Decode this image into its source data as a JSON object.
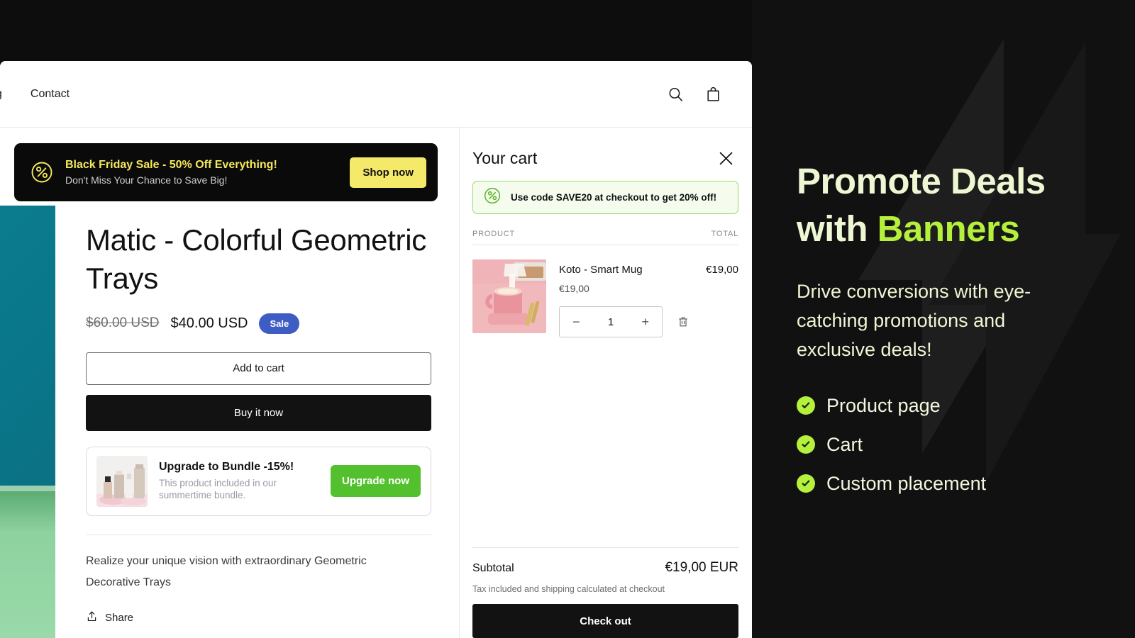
{
  "store": {
    "nav": {
      "truncated_item": "g",
      "links": [
        "Contact"
      ],
      "search_icon": "search-icon",
      "cart_icon": "shopping-bag-icon"
    },
    "black_friday_banner": {
      "icon": "percent-circle-icon",
      "title": "Black Friday Sale - 50% Off Everything!",
      "subtitle": "Don't Miss Your Chance to Save Big!",
      "button": "Shop now",
      "bg": "#0a0a0a",
      "title_color": "#f4e85c",
      "button_bg": "#f5e96a"
    },
    "product": {
      "title": "Matic - Colorful Geometric Trays",
      "price_old": "$60.00 USD",
      "price_new": "$40.00 USD",
      "sale_badge": "Sale",
      "sale_badge_color": "#3d5cc4",
      "add_to_cart": "Add to cart",
      "buy_it_now": "Buy it now",
      "description": "Realize your unique vision with extraordinary Geometric Decorative Trays",
      "share": "Share",
      "share_icon": "share-icon"
    },
    "bundle_banner": {
      "thumb": "skincare-products-thumbnail",
      "title": "Upgrade to Bundle -15%!",
      "subtitle": "This product included in our summertime bundle.",
      "button": "Upgrade now",
      "button_bg": "#53c12d"
    }
  },
  "cart": {
    "title": "Your cart",
    "close_icon": "close-icon",
    "promo": {
      "icon": "percent-circle-icon",
      "text": "Use code SAVE20 at checkout to get 20% off!",
      "border_color": "#9bd96a",
      "bg": "#f5fced"
    },
    "columns": {
      "product": "PRODUCT",
      "total": "TOTAL"
    },
    "items": [
      {
        "thumb": "pink-smart-mug-photo",
        "name": "Koto - Smart Mug",
        "unit_price": "€19,00",
        "quantity": "1",
        "decrease_label": "−",
        "increase_label": "+",
        "remove_icon": "trash-icon",
        "total": "€19,00"
      }
    ],
    "subtotal_label": "Subtotal",
    "subtotal_value": "€19,00 EUR",
    "tax_note": "Tax included and shipping calculated at checkout",
    "checkout_button": "Check out"
  },
  "promo_panel": {
    "heading_part1": "Promote Deals",
    "heading_part2": "with ",
    "heading_highlight": "Banners",
    "highlight_color": "#b4f03c",
    "subtext": "Drive conversions with eye-catching promotions and exclusive deals!",
    "features": [
      "Product page",
      "Cart",
      "Custom placement"
    ],
    "bg": "#111111",
    "text_color": "#eef7d4"
  }
}
